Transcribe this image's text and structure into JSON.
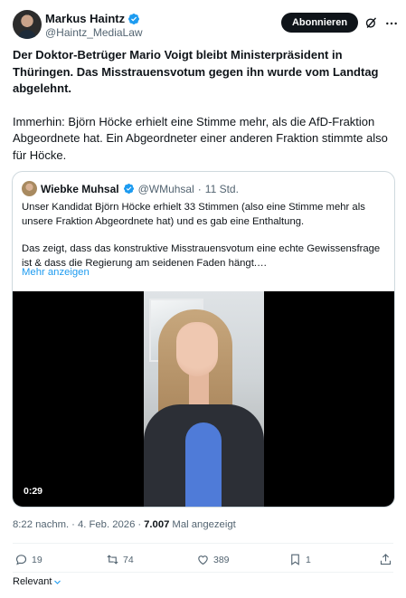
{
  "author": {
    "name": "Markus Haintz",
    "handle": "@Haintz_MediaLaw",
    "follow_label": "Abonnieren"
  },
  "tweet": {
    "line_bold": "Der Doktor-Betrüger Mario Voigt bleibt Ministerpräsident in Thüringen. Das Misstrauensvotum gegen ihn wurde vom Landtag abgelehnt.",
    "line_normal": "Immerhin: Björn Höcke erhielt eine Stimme mehr, als die AfD-Fraktion Abgeordnete hat. Ein Abgeordneter einer anderen Fraktion stimmte also für Höcke."
  },
  "quote": {
    "name": "Wiebke Muhsal",
    "handle": "@WMuhsal",
    "separator": "·",
    "time": "11 Std.",
    "para1": "Unser Kandidat Björn Höcke erhielt 33 Stimmen (also eine Stimme mehr als unsere Fraktion Abgeordnete hat) und es gab eine Enthaltung.",
    "para2": "Das zeigt, dass das konstruktive Misstrauensvotum eine echte Gewissensfrage ist & dass die Regierung am seidenen Faden hängt.…",
    "show_more": "Mehr anzeigen",
    "video_time": "0:29"
  },
  "meta": {
    "time": "8:22 nachm.",
    "separator": "·",
    "date": "4. Feb. 2026",
    "separator2": "·",
    "views": "7.007",
    "views_label": "Mal angezeigt"
  },
  "actions": {
    "replies": "19",
    "reposts": "74",
    "likes": "389",
    "bookmarks": "1"
  },
  "sort_label": "Relevant",
  "colors": {
    "accent": "#1d9bf0",
    "text": "#0f1419",
    "muted": "#536471",
    "border": "#cfd9de"
  }
}
